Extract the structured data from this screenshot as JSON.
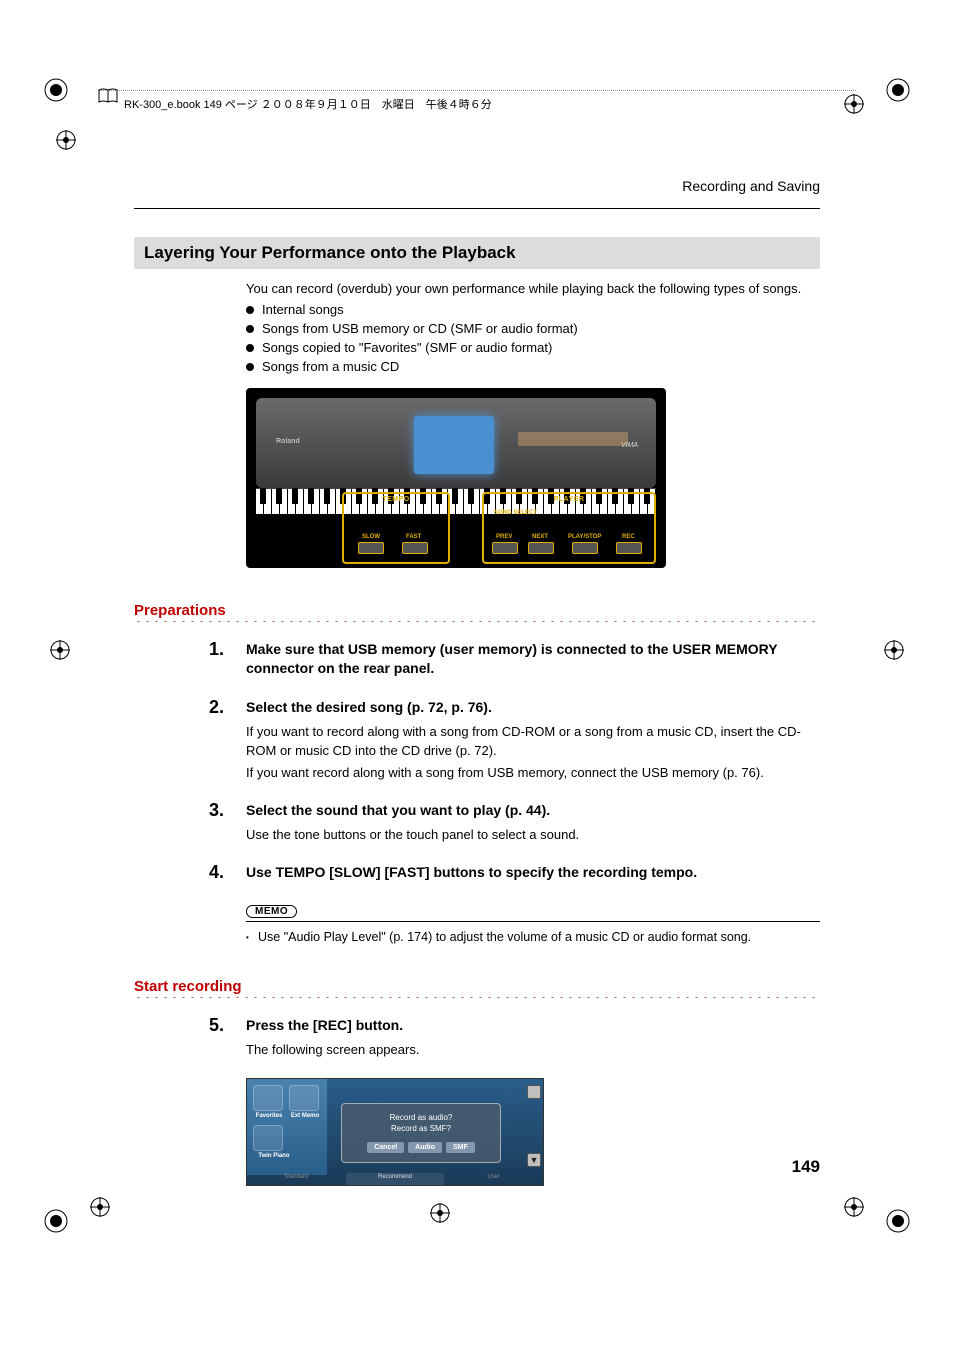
{
  "header_line": "RK-300_e.book  149 ページ  ２００８年９月１０日　水曜日　午後４時６分",
  "section_label": "Recording and Saving",
  "title": "Layering Your Performance onto the Playback",
  "intro": "You can record (overdub) your own performance while playing back the following types of songs.",
  "bullets": [
    "Internal songs",
    "Songs from USB memory or CD (SMF or audio format)",
    "Songs copied to \"Favorites\" (SMF or audio format)",
    "Songs from a music CD"
  ],
  "keyboard_labels": {
    "brand": "Roland",
    "vima": "VIMA",
    "tempo": "TEMPO",
    "player": "PLAYER",
    "slow": "SLOW",
    "fast": "FAST",
    "song_select": "SONG SELECT",
    "prev": "PREV",
    "next": "NEXT",
    "play_stop": "PLAY/STOP",
    "rec": "REC"
  },
  "preparations_heading": "Preparations",
  "steps": [
    {
      "num": "1.",
      "title": "Make sure that USB memory (user memory) is connected to the USER MEMORY connector on the rear panel.",
      "desc": []
    },
    {
      "num": "2.",
      "title": "Select the desired song (p. 72, p. 76).",
      "desc": [
        "If you want to record along with a song from CD-ROM or a song from a music CD, insert the CD-ROM or music CD into the CD drive (p. 72).",
        "If you want record along with a song from USB memory, connect the USB memory (p. 76)."
      ]
    },
    {
      "num": "3.",
      "title": "Select the sound that you want to play (p. 44).",
      "desc": [
        "Use the tone buttons or the touch panel to select a sound."
      ]
    },
    {
      "num": "4.",
      "title": "Use TEMPO [SLOW] [FAST]  buttons to specify the recording tempo.",
      "desc": []
    }
  ],
  "memo_label": "MEMO",
  "memo_text": "Use \"Audio Play Level\" (p. 174) to adjust the volume of a music CD or audio format song.",
  "start_recording_heading": "Start recording",
  "step5": {
    "num": "5.",
    "title": "Press the [REC] button.",
    "desc": "The following screen appears."
  },
  "screen": {
    "favorites": "Favorites",
    "ext_memo": "Ext Memo",
    "twin_piano": "Twin Piano",
    "dialog_line1": "Record as audio?",
    "dialog_line2": "Record as SMF?",
    "cancel": "Cancel",
    "audio": "Audio",
    "smf": "SMF",
    "tab_standard": "Standard",
    "tab_recommend": "Recommend",
    "tab_user": "User"
  },
  "page_number": "149"
}
